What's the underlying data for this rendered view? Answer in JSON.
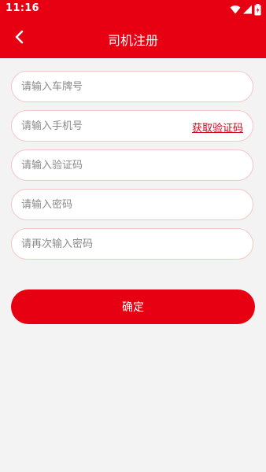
{
  "status_bar": {
    "time": "11:16",
    "icons": [
      "wifi-icon",
      "signal-icon",
      "battery-icon"
    ]
  },
  "header": {
    "title": "司机注册",
    "back_icon": "chevron-left-icon"
  },
  "form": {
    "plate_placeholder": "请输入车牌号",
    "phone_placeholder": "请输入手机号",
    "get_code_label": "获取验证码",
    "code_placeholder": "请输入验证码",
    "password_placeholder": "请输入密码",
    "password_confirm_placeholder": "请再次输入密码",
    "submit_label": "确定"
  },
  "colors": {
    "brand": "#e60012",
    "background": "#f3f3f3",
    "field_border": "#f3c6c6",
    "link": "#d0021b"
  }
}
